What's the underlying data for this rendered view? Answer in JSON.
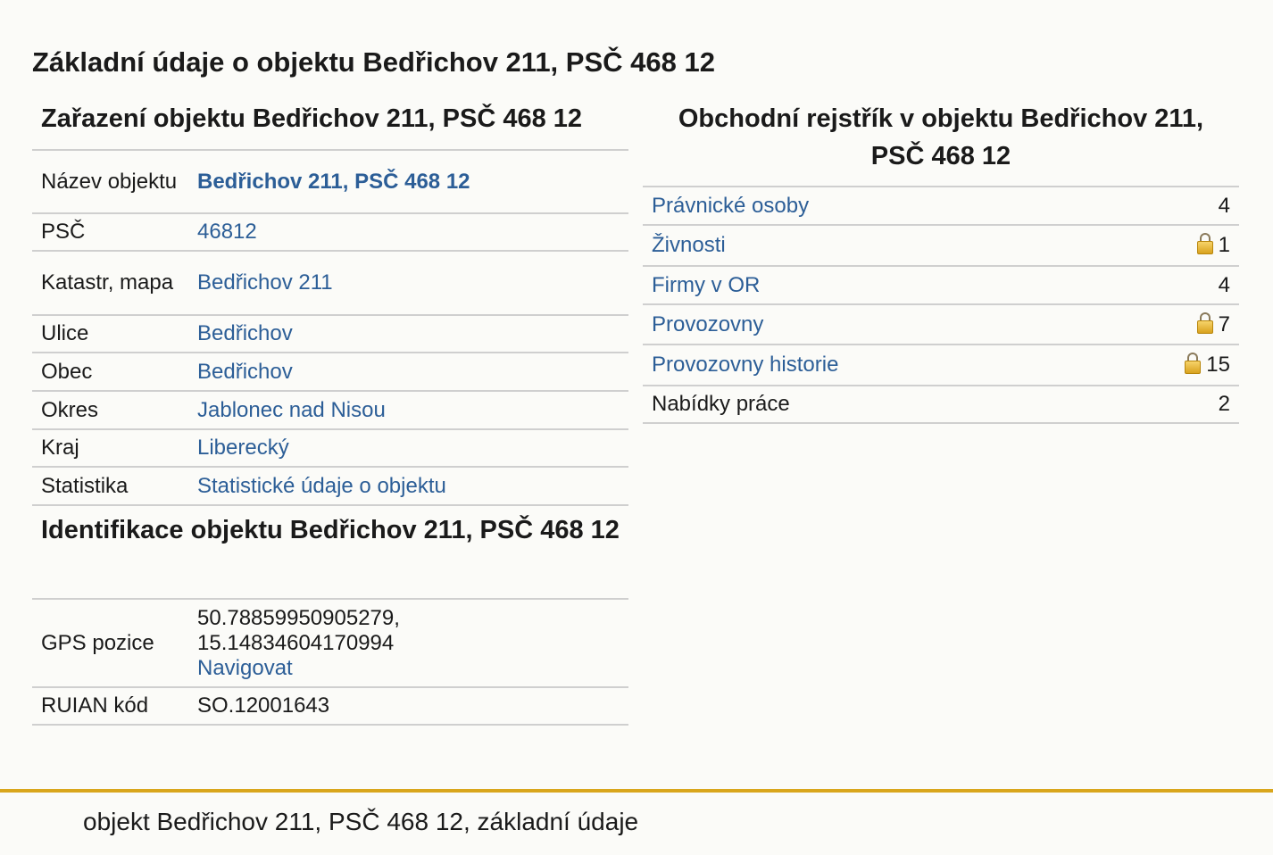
{
  "page": {
    "title": "Základní údaje o objektu Bedřichov 211, PSČ 468 12",
    "footer": "objekt Bedřichov 211, PSČ 468 12, základní údaje"
  },
  "classification": {
    "heading": "Zařazení objektu Bedřichov 211, PSČ 468 12",
    "rows": [
      {
        "label": "Název objektu",
        "value": "Bedřichov 211, PSČ 468 12"
      },
      {
        "label": "PSČ",
        "value": "46812"
      },
      {
        "label": "Katastr, mapa",
        "value": "Bedřichov 211"
      },
      {
        "label": "Ulice",
        "value": "Bedřichov"
      },
      {
        "label": "Obec",
        "value": "Bedřichov"
      },
      {
        "label": "Okres",
        "value": "Jablonec nad Nisou"
      },
      {
        "label": "Kraj",
        "value": "Liberecký"
      },
      {
        "label": "Statistika",
        "value": "Statistické údaje o objektu"
      }
    ]
  },
  "identification": {
    "heading": "Identifikace objektu Bedřichov 211, PSČ 468 12",
    "gps_label": "GPS pozice",
    "gps_lat": "50.78859950905279,",
    "gps_lon": "15.14834604170994",
    "navigate_label": "Navigovat",
    "ruian_label": "RUIAN kód",
    "ruian_value": "SO.12001643"
  },
  "registry": {
    "heading": "Obchodní rejstřík v objektu Bedřichov 211, PSČ 468 12",
    "rows": [
      {
        "label": "Právnické osoby",
        "count": "4",
        "locked": false
      },
      {
        "label": "Živnosti",
        "count": "1",
        "locked": true
      },
      {
        "label": "Firmy v OR",
        "count": "4",
        "locked": false
      },
      {
        "label": "Provozovny",
        "count": "7",
        "locked": true
      },
      {
        "label": "Provozovny historie",
        "count": "15",
        "locked": true
      },
      {
        "label": "Nabídky práce",
        "count": "2",
        "locked": false
      }
    ]
  },
  "colors": {
    "link": "#2c5e97",
    "footer_rule": "#d9a61c",
    "background": "#fbfbf8"
  }
}
